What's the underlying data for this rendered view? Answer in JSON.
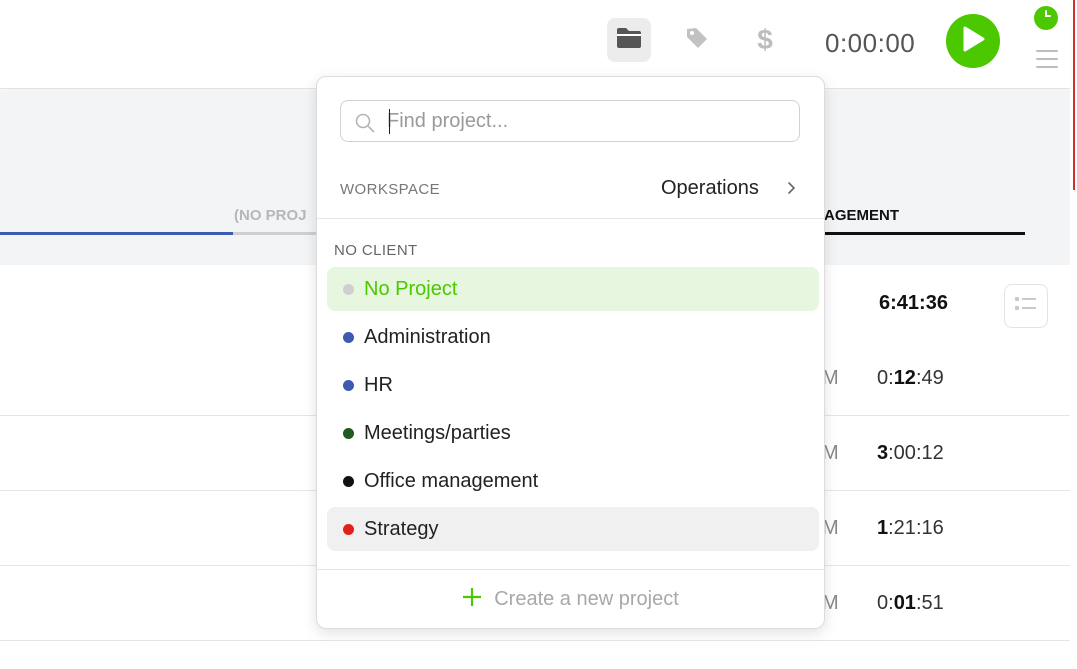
{
  "topbar": {
    "timer": "0:00:00",
    "icons": [
      "folder-icon",
      "tag-icon",
      "dollar-icon",
      "play-icon",
      "clock-icon",
      "menu-icon"
    ],
    "accent_color": "#4bc800"
  },
  "background": {
    "tab_no_project": "(NO PROJ",
    "tab_management": "AGEMENT",
    "total_duration": "6:41:36",
    "rows": [
      {
        "time_fragment": "M",
        "duration": {
          "h": "0:",
          "m": "12",
          "s": ":49"
        }
      },
      {
        "time_fragment": "M",
        "duration": {
          "h": "3",
          "m": ":00",
          "s": ":12"
        }
      },
      {
        "time_fragment": "M",
        "duration": {
          "h": "1",
          "m": ":21",
          "s": ":16"
        }
      },
      {
        "time_fragment": "M",
        "duration": {
          "h": "0:",
          "m": "01",
          "s": ":51"
        }
      }
    ]
  },
  "dropdown": {
    "search": {
      "placeholder": "Find project...",
      "value": ""
    },
    "workspace": {
      "label": "WORKSPACE",
      "value": "Operations"
    },
    "group_label": "NO CLIENT",
    "projects": [
      {
        "label": "No Project",
        "color": "#cfcfcf",
        "state": "selected"
      },
      {
        "label": "Administration",
        "color": "#3d5bb0",
        "state": ""
      },
      {
        "label": "HR",
        "color": "#3d5bb0",
        "state": ""
      },
      {
        "label": "Meetings/parties",
        "color": "#1f5a1f",
        "state": ""
      },
      {
        "label": "Office management",
        "color": "#111111",
        "state": ""
      },
      {
        "label": "Strategy",
        "color": "#e0201b",
        "state": "hover"
      }
    ],
    "create_label": "Create a new project"
  }
}
